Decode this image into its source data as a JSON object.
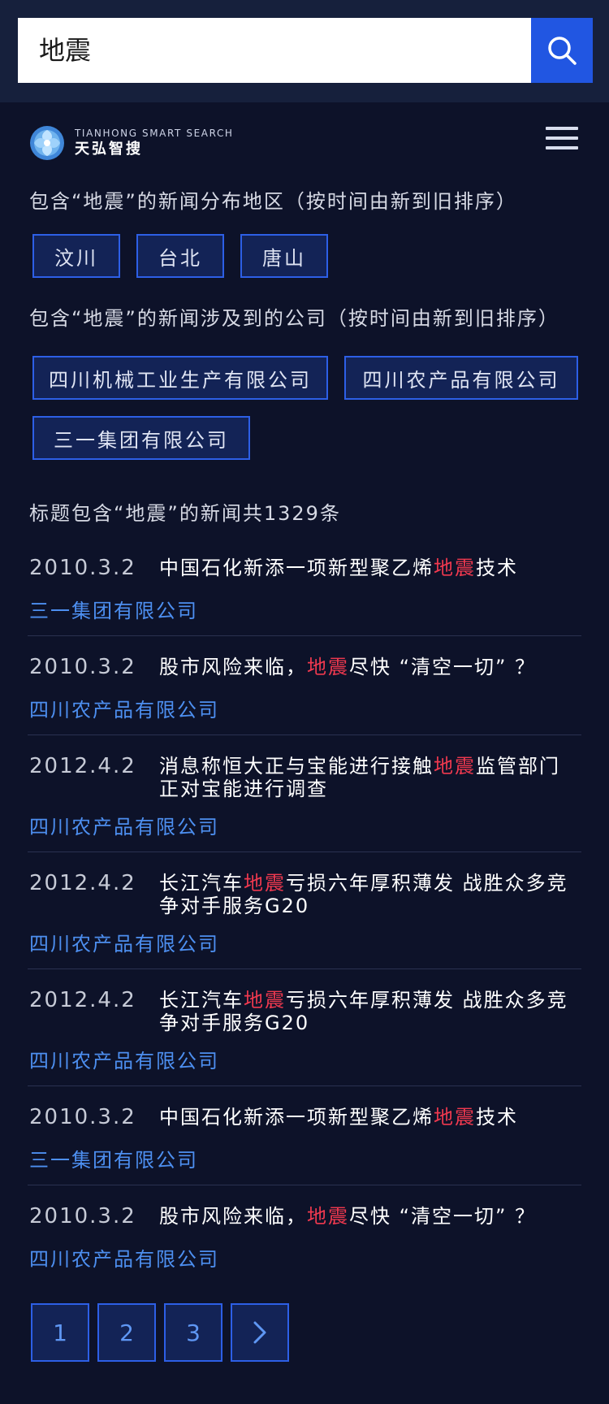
{
  "search": {
    "query": "地震"
  },
  "brand": {
    "name_en": "TIANHONG SMART SEARCH",
    "name_cn": "天弘智搜"
  },
  "regions": {
    "label": "包含“地震”的新闻分布地区（按时间由新到旧排序）",
    "tags": [
      "汶川",
      "台北",
      "唐山"
    ]
  },
  "companies": {
    "label": "包含“地震”的新闻涉及到的公司（按时间由新到旧排序）",
    "tags": [
      "四川机械工业生产有限公司",
      "四川农产品有限公司",
      "三一集团有限公司"
    ]
  },
  "results": {
    "summary": "标题包含“地震”的新闻共1329条",
    "highlight_color": "#f0394f",
    "items": [
      {
        "date": "2010.3.2",
        "title_before": "中国石化新添一项新型聚乙烯",
        "highlight": "地震",
        "title_after": "技术",
        "company": "三一集团有限公司"
      },
      {
        "date": "2010.3.2",
        "title_before": "股市风险来临，",
        "highlight": "地震",
        "title_after": "尽快 “清空一切” ？",
        "company": "四川农产品有限公司"
      },
      {
        "date": "2012.4.2",
        "title_before": "消息称恒大正与宝能进行接触",
        "highlight": "地震",
        "title_after": "监管部门正对宝能进行调查",
        "company": "四川农产品有限公司"
      },
      {
        "date": "2012.4.2",
        "title_before": "长江汽车",
        "highlight": "地震",
        "title_after": "亏损六年厚积薄发 战胜众多竞争对手服务G20",
        "company": "四川农产品有限公司"
      },
      {
        "date": "2012.4.2",
        "title_before": "长江汽车",
        "highlight": "地震",
        "title_after": "亏损六年厚积薄发 战胜众多竞争对手服务G20",
        "company": "四川农产品有限公司"
      },
      {
        "date": "2010.3.2",
        "title_before": "中国石化新添一项新型聚乙烯",
        "highlight": "地震",
        "title_after": "技术",
        "company": "三一集团有限公司"
      },
      {
        "date": "2010.3.2",
        "title_before": "股市风险来临，",
        "highlight": "地震",
        "title_after": "尽快 “清空一切” ？",
        "company": "四川农产品有限公司"
      }
    ]
  },
  "pagination": {
    "pages": [
      "1",
      "2",
      "3"
    ],
    "next_icon": "chevron-right-icon"
  }
}
